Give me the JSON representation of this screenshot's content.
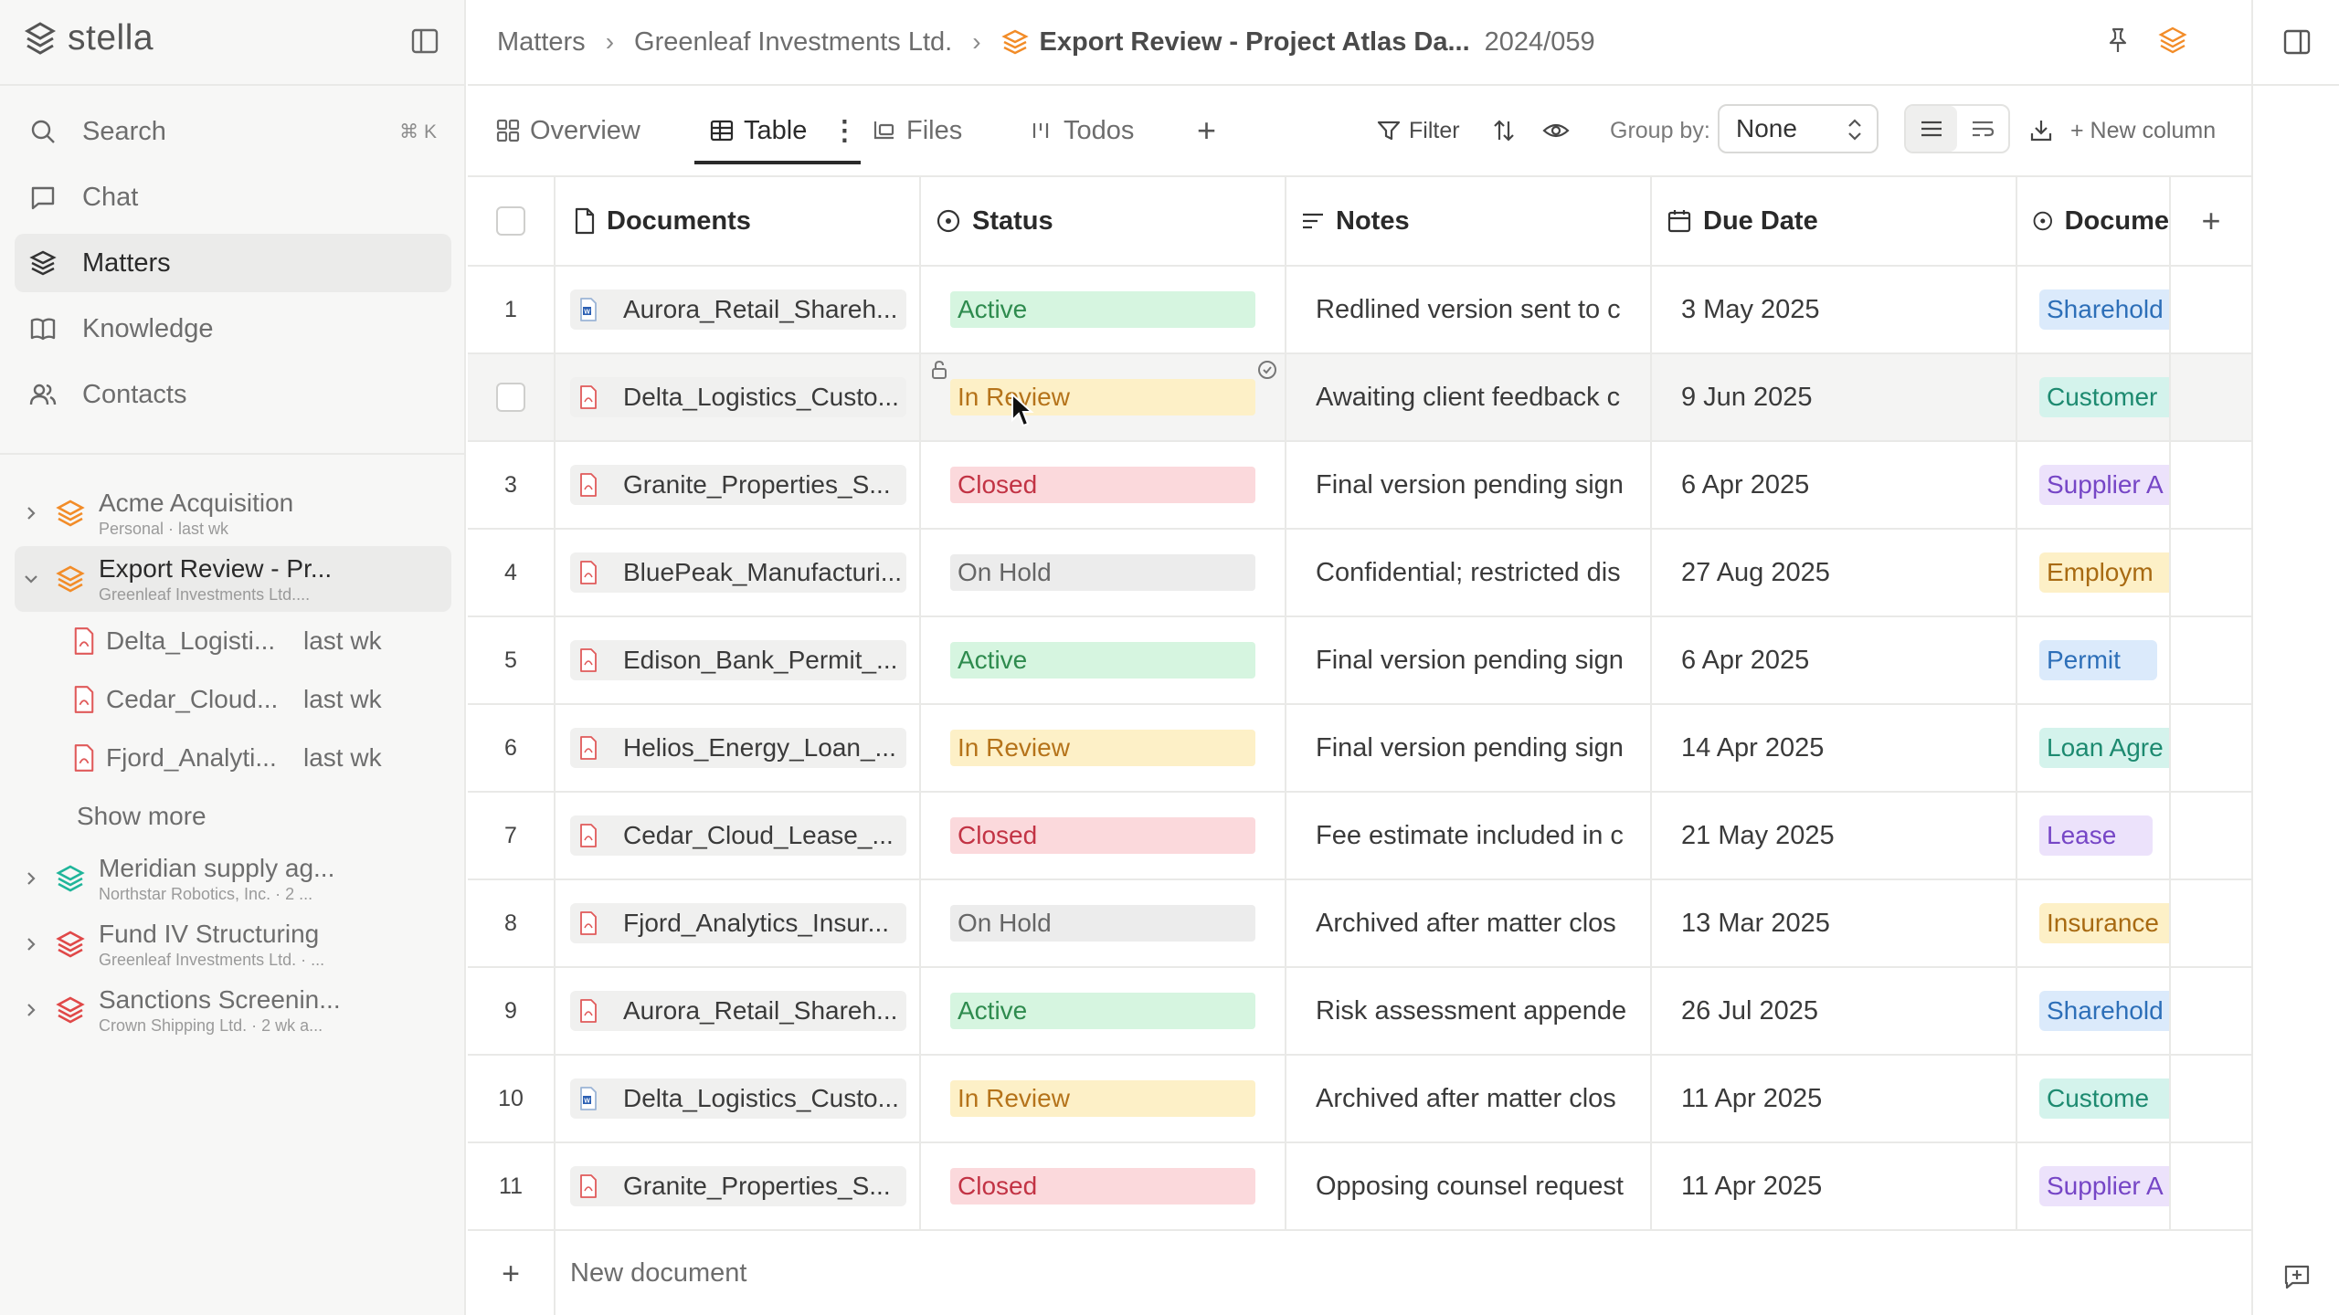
{
  "app": {
    "name": "stella"
  },
  "sidebar": {
    "nav": [
      {
        "label": "Search",
        "icon": "search-icon",
        "shortcut": "⌘ K"
      },
      {
        "label": "Chat",
        "icon": "chat-icon"
      },
      {
        "label": "Matters",
        "icon": "layers-icon",
        "active": true
      },
      {
        "label": "Knowledge",
        "icon": "book-icon"
      },
      {
        "label": "Contacts",
        "icon": "contacts-icon"
      }
    ],
    "matters": [
      {
        "name": "Acme Acquisition",
        "sub": "Personal · last wk",
        "color": "#f28c28"
      },
      {
        "name": "Export Review - Pr...",
        "sub": "Greenleaf Investments Ltd....",
        "color": "#f28c28",
        "expanded": true
      },
      {
        "name": "Meridian supply ag...",
        "sub": "Northstar Robotics, Inc. · 2 ...",
        "color": "#1fb59a"
      },
      {
        "name": "Fund IV Structuring",
        "sub": "Greenleaf Investments Ltd. · ...",
        "color": "#e04848"
      },
      {
        "name": "Sanctions Screenin...",
        "sub": "Crown Shipping Ltd. · 2 wk a...",
        "color": "#e04848"
      }
    ],
    "children": [
      {
        "name": "Delta_Logisti...",
        "time": "last wk"
      },
      {
        "name": "Cedar_Cloud...",
        "time": "last wk"
      },
      {
        "name": "Fjord_Analyti...",
        "time": "last wk"
      }
    ],
    "show_more": "Show more"
  },
  "breadcrumb": {
    "items": [
      "Matters",
      "Greenleaf Investments Ltd."
    ],
    "current": "Export Review - Project Atlas Da...",
    "id": "2024/059"
  },
  "tabs": [
    {
      "label": "Overview",
      "icon": "grid-icon"
    },
    {
      "label": "Table",
      "icon": "table-icon",
      "active": true
    },
    {
      "label": "Files",
      "icon": "files-icon"
    },
    {
      "label": "Todos",
      "icon": "todos-icon"
    }
  ],
  "toolbar": {
    "filter_label": "Filter",
    "groupby_label": "Group by:",
    "groupby_value": "None",
    "new_column_label": "+ New column"
  },
  "columns": {
    "documents": "Documents",
    "status": "Status",
    "notes": "Notes",
    "due_date": "Due Date",
    "document_type": "Docume"
  },
  "status_colors": {
    "Active": {
      "bg": "#d6f5e0",
      "fg": "#2e8b4e"
    },
    "In Review": {
      "bg": "#fdf0c7",
      "fg": "#b5731a"
    },
    "Closed": {
      "bg": "#fbd9dc",
      "fg": "#c23344"
    },
    "On Hold": {
      "bg": "#ececec",
      "fg": "#666666"
    }
  },
  "rows": [
    {
      "num": "1",
      "doc": "Aurora_Retail_Shareh...",
      "file": "word",
      "status": "Active",
      "notes": "Redlined version sent to c",
      "due": "3 May 2025",
      "type": "Sharehold",
      "type_bg": "#dbeafb",
      "type_fg": "#2d6fb8"
    },
    {
      "num": "",
      "doc": "Delta_Logistics_Custo...",
      "file": "pdf",
      "status": "In Review",
      "notes": "Awaiting client feedback c",
      "due": "9 Jun 2025",
      "type": "Customer",
      "type_bg": "#d4f3ec",
      "type_fg": "#1d8a70",
      "hover": true
    },
    {
      "num": "3",
      "doc": "Granite_Properties_S...",
      "file": "pdf",
      "status": "Closed",
      "notes": "Final version pending sign",
      "due": "6 Apr 2025",
      "type": "Supplier A",
      "type_bg": "#ece2fb",
      "type_fg": "#7646c6"
    },
    {
      "num": "4",
      "doc": "BluePeak_Manufacturi...",
      "file": "pdf",
      "status": "On Hold",
      "notes": "Confidential; restricted dis",
      "due": "27 Aug 2025",
      "type": "Employm",
      "type_bg": "#fdf0c7",
      "type_fg": "#a86a12"
    },
    {
      "num": "5",
      "doc": "Edison_Bank_Permit_...",
      "file": "pdf",
      "status": "Active",
      "notes": "Final version pending sign",
      "due": "6 Apr 2025",
      "type": "Permit",
      "type_bg": "#dbeafb",
      "type_fg": "#2d6fb8"
    },
    {
      "num": "6",
      "doc": "Helios_Energy_Loan_...",
      "file": "pdf",
      "status": "In Review",
      "notes": "Final version pending sign",
      "due": "14 Apr 2025",
      "type": "Loan Agre",
      "type_bg": "#d4f3ec",
      "type_fg": "#1d8a70"
    },
    {
      "num": "7",
      "doc": "Cedar_Cloud_Lease_...",
      "file": "pdf",
      "status": "Closed",
      "notes": "Fee estimate included in c",
      "due": "21 May 2025",
      "type": "Lease",
      "type_bg": "#ece2fb",
      "type_fg": "#7646c6"
    },
    {
      "num": "8",
      "doc": "Fjord_Analytics_Insur...",
      "file": "pdf",
      "status": "On Hold",
      "notes": "Archived after matter clos",
      "due": "13 Mar 2025",
      "type": "Insurance",
      "type_bg": "#fdf0c7",
      "type_fg": "#a86a12"
    },
    {
      "num": "9",
      "doc": "Aurora_Retail_Shareh...",
      "file": "pdf",
      "status": "Active",
      "notes": "Risk assessment appende",
      "due": "26 Jul 2025",
      "type": "Sharehold",
      "type_bg": "#dbeafb",
      "type_fg": "#2d6fb8"
    },
    {
      "num": "10",
      "doc": "Delta_Logistics_Custo...",
      "file": "word",
      "status": "In Review",
      "notes": "Archived after matter clos",
      "due": "11 Apr 2025",
      "type": "Custome",
      "type_bg": "#d4f3ec",
      "type_fg": "#1d8a70"
    },
    {
      "num": "11",
      "doc": "Granite_Properties_S...",
      "file": "pdf",
      "status": "Closed",
      "notes": "Opposing counsel request",
      "due": "11 Apr 2025",
      "type": "Supplier A",
      "type_bg": "#ece2fb",
      "type_fg": "#7646c6"
    }
  ],
  "new_document_label": "New document"
}
